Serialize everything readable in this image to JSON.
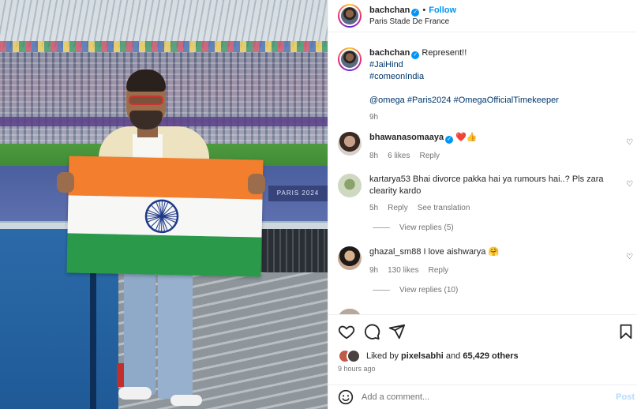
{
  "header": {
    "username": "bachchan",
    "dot": "•",
    "follow_label": "Follow",
    "location": "Paris Stade De France"
  },
  "photo": {
    "track_sign": "PARIS 2024"
  },
  "caption": {
    "username": "bachchan",
    "text": "Represent!!",
    "hashtag_1": "#JaiHind",
    "hashtag_2": "#comeonIndia",
    "mention": "@omega",
    "hashtag_3": "#Paris2024",
    "hashtag_4": "#OmegaOfficialTimekeeper",
    "time": "9h"
  },
  "comments": [
    {
      "username": "bhawanasomaaya",
      "verified": true,
      "text_emoji": "❤️👍",
      "time": "8h",
      "likes": "6 likes",
      "reply": "Reply"
    },
    {
      "username": "kartarya53",
      "text": "Bhai divorce pakka hai ya rumours hai..? Pls zara clearity kardo",
      "time": "5h",
      "reply": "Reply",
      "translation": "See translation",
      "view_replies": "View replies (5)"
    },
    {
      "username": "ghazal_sm88",
      "text": "I love aishwarya",
      "emoji": "🤗",
      "time": "9h",
      "likes": "130 likes",
      "reply": "Reply",
      "view_replies": "View replies (10)"
    }
  ],
  "likes": {
    "prefix": "Liked by",
    "user": "pixelsabhi",
    "and": "and",
    "others": "65,429 others"
  },
  "timeago": "9 hours ago",
  "comment_input": {
    "placeholder": "Add a comment...",
    "post_label": "Post"
  },
  "colors": {
    "link": "#0095f6",
    "hashtag": "#00376b",
    "heart": "#e0245e",
    "saffron": "#f37e2d",
    "green": "#2a9a4a",
    "chakra": "#1f3a8a"
  }
}
